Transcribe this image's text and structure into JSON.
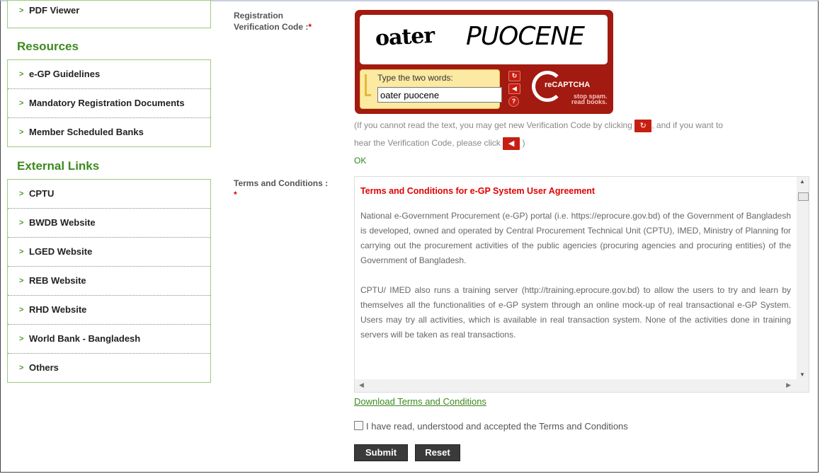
{
  "sidebar": {
    "top_item": "PDF Viewer",
    "resources_heading": "Resources",
    "resources": [
      "e-GP Guidelines",
      "Mandatory Registration Documents",
      "Member Scheduled Banks"
    ],
    "external_heading": "External Links",
    "external": [
      "CPTU",
      "BWDB Website",
      "LGED Website",
      "REB Website",
      "RHD Website",
      "World Bank - Bangladesh",
      "Others"
    ]
  },
  "form": {
    "verification_label_1": "Registration",
    "verification_label_2": "Verification Code :",
    "required_mark": "*",
    "captcha": {
      "word1": "oater",
      "word2": "PUOCENE",
      "prompt": "Type the two words:",
      "input_value": "oater puocene",
      "brand": "reCAPTCHA",
      "tagline_1": "stop spam.",
      "tagline_2": "read books."
    },
    "hint_1": "(If you cannot read the text, you may get new Verification Code by clicking",
    "hint_2": ", and if you want to",
    "hint_3": "hear the Verification Code, please click",
    "hint_4": ")",
    "ok_text": "OK",
    "terms_label": "Terms and Conditions :",
    "terms_title": "Terms and Conditions for e-GP System User Agreement",
    "terms_p1": "National e-Government Procurement (e-GP) portal (i.e. https://eprocure.gov.bd) of the Government of Bangladesh is developed, owned and operated by Central Procurement Technical Unit (CPTU), IMED, Ministry of Planning for carrying out the procurement activities of the public agencies (procuring agencies and procuring entities) of the Government of Bangladesh.",
    "terms_p2": "CPTU/ IMED also runs a training server (http://training.eprocure.gov.bd) to allow the users to try and learn by themselves all the functionalities of e-GP system through an online mock-up of real transactional e-GP System. Users may try all activities, which is available in real transaction system. None of the activities done in training servers will be taken as real transactions.",
    "download_link": "Download Terms and Conditions",
    "agree_text": "I have read, understood and accepted the Terms and Conditions",
    "submit_label": "Submit",
    "reset_label": "Reset"
  },
  "colors": {
    "accent": "#3d8a1f",
    "captcha": "#a31a10",
    "required": "#dd0000"
  }
}
